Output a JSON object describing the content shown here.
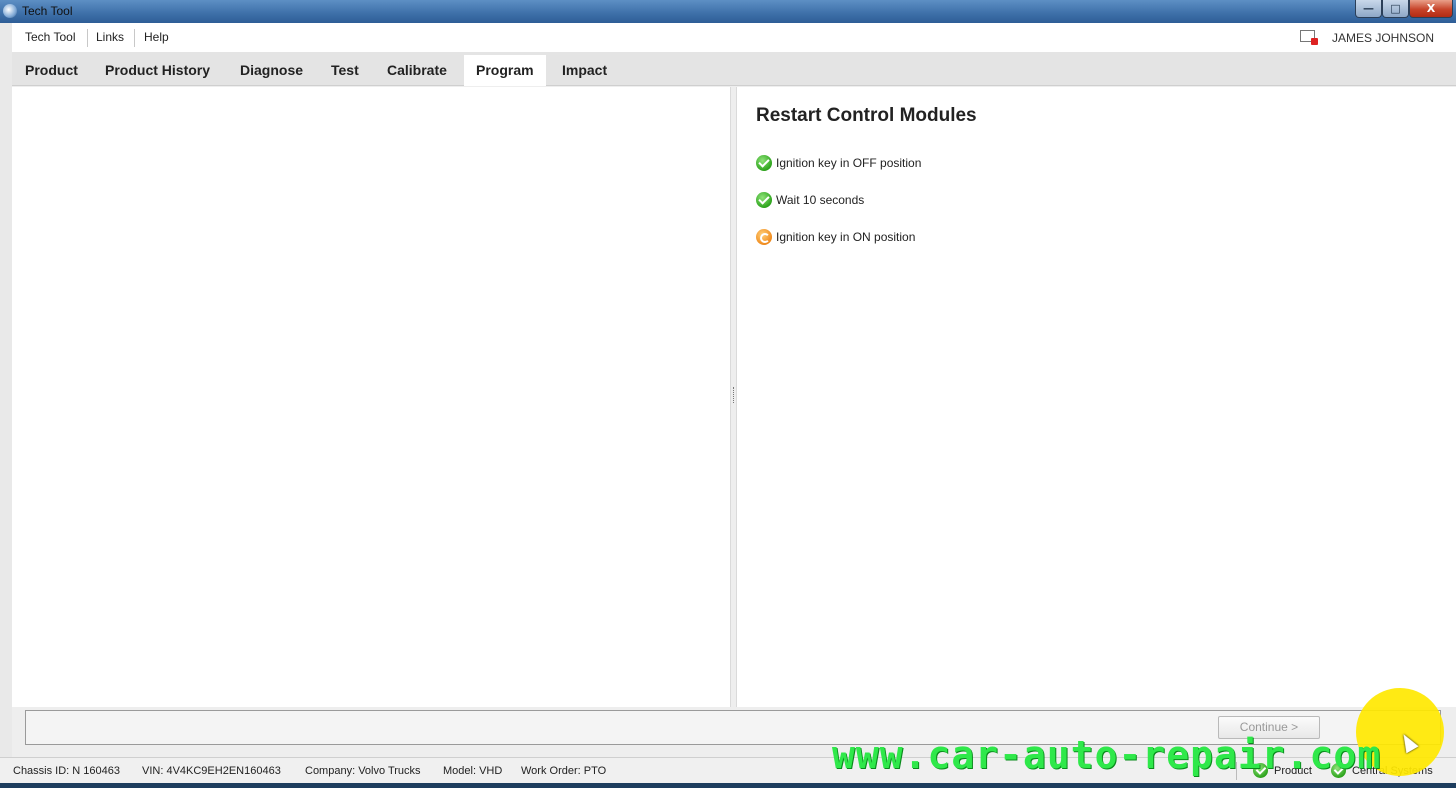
{
  "window": {
    "title": "Tech Tool",
    "controls": {
      "minimize": "—",
      "maximize": "□",
      "close": "X"
    }
  },
  "menu": {
    "items": [
      "Tech Tool",
      "Links",
      "Help"
    ],
    "user_name": "JAMES JOHNSON"
  },
  "tabs": [
    {
      "label": "Product",
      "active": false
    },
    {
      "label": "Product History",
      "active": false
    },
    {
      "label": "Diagnose",
      "active": false
    },
    {
      "label": "Test",
      "active": false
    },
    {
      "label": "Calibrate",
      "active": false
    },
    {
      "label": "Program",
      "active": true
    },
    {
      "label": "Impact",
      "active": false
    }
  ],
  "panel": {
    "heading": "Restart Control Modules",
    "steps": [
      {
        "icon": "check-icon",
        "status": "done",
        "text": "Ignition key in OFF position"
      },
      {
        "icon": "check-icon",
        "status": "done",
        "text": "Wait 10 seconds"
      },
      {
        "icon": "progress-icon",
        "status": "in-progress",
        "text": "Ignition key in ON position"
      }
    ]
  },
  "actions": {
    "continue_label": "Continue >"
  },
  "status": {
    "chassis": "Chassis ID: N 160463",
    "vin": "VIN: 4V4KC9EH2EN160463",
    "company": "Company: Volvo Trucks",
    "model": "Model: VHD",
    "work_order": "Work Order: PTO",
    "indicators": [
      {
        "icon": "check-icon",
        "label": "Product"
      },
      {
        "icon": "check-icon",
        "label": "Central Systems"
      }
    ]
  },
  "watermark": "www.car-auto-repair.com",
  "colors": {
    "titlebar": "#3d6fa8",
    "done": "#2ea41d",
    "pending": "#f08a1c",
    "watermark": "#2fe84a",
    "cursor_highlight": "#ffe800"
  }
}
